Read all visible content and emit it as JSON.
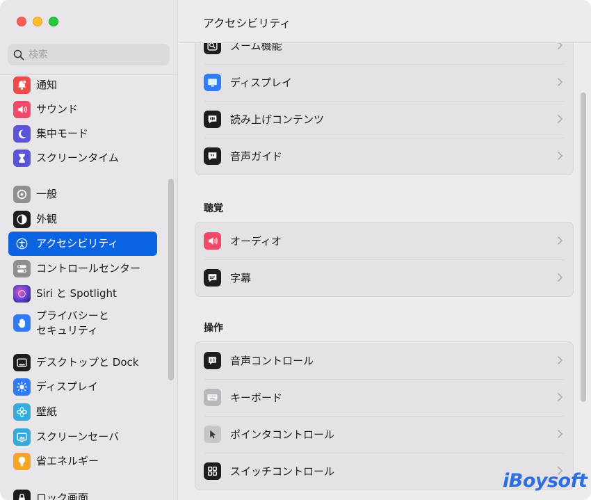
{
  "colors": {
    "accent": "#0a63e0",
    "watermark": "#2f6ee0"
  },
  "search": {
    "placeholder": "検索"
  },
  "sidebar": {
    "items": [
      {
        "label": "通知",
        "icon": "bell-icon",
        "color": "#f04a49"
      },
      {
        "label": "サウンド",
        "icon": "speaker-icon",
        "color": "#f04a6a"
      },
      {
        "label": "集中モード",
        "icon": "moon-icon",
        "color": "#5b54d6"
      },
      {
        "label": "スクリーンタイム",
        "icon": "hourglass-icon",
        "color": "#5b54d6"
      },
      {
        "label": "一般",
        "icon": "gear-icon",
        "color": "#8e8e93"
      },
      {
        "label": "外観",
        "icon": "appearance-icon",
        "color": "#1d1d1f"
      },
      {
        "label": "アクセシビリティ",
        "icon": "accessibility-icon",
        "color": "#0a63e0",
        "selected": true
      },
      {
        "label": "コントロールセンター",
        "icon": "switches-icon",
        "color": "#8e8e93"
      },
      {
        "label": "Siri と Spotlight",
        "icon": "siri-icon",
        "color": "#3a2d5c"
      },
      {
        "label": "プライバシーと\nセキュリティ",
        "icon": "hand-icon",
        "color": "#2f7cf6"
      },
      {
        "label": "デスクトップと Dock",
        "icon": "dock-icon",
        "color": "#1d1d1f"
      },
      {
        "label": "ディスプレイ",
        "icon": "sun-icon",
        "color": "#2f7cf6"
      },
      {
        "label": "壁紙",
        "icon": "flower-icon",
        "color": "#35aadc"
      },
      {
        "label": "スクリーンセーバ",
        "icon": "screensaver-icon",
        "color": "#35aadc"
      },
      {
        "label": "省エネルギー",
        "icon": "bulb-icon",
        "color": "#f5a623"
      },
      {
        "label": "ロック画面",
        "icon": "lock-icon",
        "color": "#1d1d1f"
      }
    ]
  },
  "main": {
    "title": "アクセシビリティ",
    "vision_group": [
      {
        "label": "ズーム機能",
        "icon": "zoom-icon"
      },
      {
        "label": "ディスプレイ",
        "icon": "display-icon"
      },
      {
        "label": "読み上げコンテンツ",
        "icon": "spoken-content-icon"
      },
      {
        "label": "音声ガイド",
        "icon": "voiceover-icon"
      }
    ],
    "hearing_title": "聴覚",
    "hearing_group": [
      {
        "label": "オーディオ",
        "icon": "audio-icon"
      },
      {
        "label": "字幕",
        "icon": "captions-icon"
      }
    ],
    "motor_title": "操作",
    "motor_group": [
      {
        "label": "音声コントロール",
        "icon": "voice-control-icon"
      },
      {
        "label": "キーボード",
        "icon": "keyboard-icon"
      },
      {
        "label": "ポインタコントロール",
        "icon": "pointer-icon"
      },
      {
        "label": "スイッチコントロール",
        "icon": "switch-control-icon"
      }
    ]
  },
  "watermark": "iBoysoft"
}
